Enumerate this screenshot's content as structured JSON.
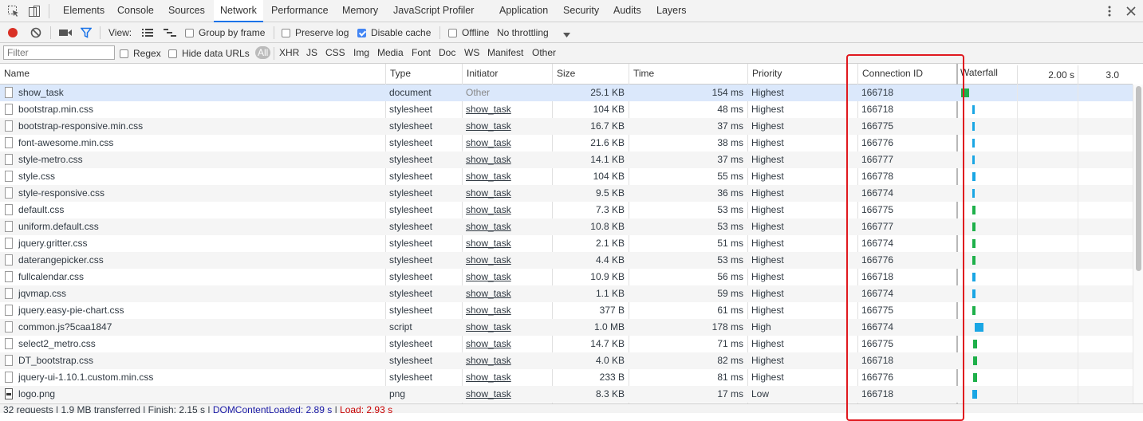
{
  "tabs": [
    "Elements",
    "Console",
    "Sources",
    "Network",
    "Performance",
    "Memory",
    "JavaScript Profiler",
    "Application",
    "Security",
    "Audits",
    "Layers"
  ],
  "toolbar": {
    "view_label": "View:",
    "group_by_frame": "Group by frame",
    "preserve_log": "Preserve log",
    "disable_cache": "Disable cache",
    "offline": "Offline",
    "throttling": "No throttling",
    "disable_cache_checked": true
  },
  "filterbar": {
    "placeholder": "Filter",
    "regex": "Regex",
    "hide_data_urls": "Hide data URLs",
    "types": [
      "All",
      "XHR",
      "JS",
      "CSS",
      "Img",
      "Media",
      "Font",
      "Doc",
      "WS",
      "Manifest",
      "Other"
    ]
  },
  "columns": {
    "name": "Name",
    "type": "Type",
    "initiator": "Initiator",
    "size": "Size",
    "time": "Time",
    "priority": "Priority",
    "connection": "Connection ID",
    "waterfall": "Waterfall",
    "tick1": "2.00 s",
    "tick2": "3.0"
  },
  "rows": [
    {
      "name": "show_task",
      "type": "document",
      "initiator": "Other",
      "size": "25.1 KB",
      "time": "154 ms",
      "priority": "Highest",
      "conn": "166718"
    },
    {
      "name": "bootstrap.min.css",
      "type": "stylesheet",
      "initiator": "show_task",
      "size": "104 KB",
      "time": "48 ms",
      "priority": "Highest",
      "conn": "166718"
    },
    {
      "name": "bootstrap-responsive.min.css",
      "type": "stylesheet",
      "initiator": "show_task",
      "size": "16.7 KB",
      "time": "37 ms",
      "priority": "Highest",
      "conn": "166775"
    },
    {
      "name": "font-awesome.min.css",
      "type": "stylesheet",
      "initiator": "show_task",
      "size": "21.6 KB",
      "time": "38 ms",
      "priority": "Highest",
      "conn": "166776"
    },
    {
      "name": "style-metro.css",
      "type": "stylesheet",
      "initiator": "show_task",
      "size": "14.1 KB",
      "time": "37 ms",
      "priority": "Highest",
      "conn": "166777"
    },
    {
      "name": "style.css",
      "type": "stylesheet",
      "initiator": "show_task",
      "size": "104 KB",
      "time": "55 ms",
      "priority": "Highest",
      "conn": "166778"
    },
    {
      "name": "style-responsive.css",
      "type": "stylesheet",
      "initiator": "show_task",
      "size": "9.5 KB",
      "time": "36 ms",
      "priority": "Highest",
      "conn": "166774"
    },
    {
      "name": "default.css",
      "type": "stylesheet",
      "initiator": "show_task",
      "size": "7.3 KB",
      "time": "53 ms",
      "priority": "Highest",
      "conn": "166775"
    },
    {
      "name": "uniform.default.css",
      "type": "stylesheet",
      "initiator": "show_task",
      "size": "10.8 KB",
      "time": "53 ms",
      "priority": "Highest",
      "conn": "166777"
    },
    {
      "name": "jquery.gritter.css",
      "type": "stylesheet",
      "initiator": "show_task",
      "size": "2.1 KB",
      "time": "51 ms",
      "priority": "Highest",
      "conn": "166774"
    },
    {
      "name": "daterangepicker.css",
      "type": "stylesheet",
      "initiator": "show_task",
      "size": "4.4 KB",
      "time": "53 ms",
      "priority": "Highest",
      "conn": "166776"
    },
    {
      "name": "fullcalendar.css",
      "type": "stylesheet",
      "initiator": "show_task",
      "size": "10.9 KB",
      "time": "56 ms",
      "priority": "Highest",
      "conn": "166718"
    },
    {
      "name": "jqvmap.css",
      "type": "stylesheet",
      "initiator": "show_task",
      "size": "1.1 KB",
      "time": "59 ms",
      "priority": "Highest",
      "conn": "166774"
    },
    {
      "name": "jquery.easy-pie-chart.css",
      "type": "stylesheet",
      "initiator": "show_task",
      "size": "377 B",
      "time": "61 ms",
      "priority": "Highest",
      "conn": "166775"
    },
    {
      "name": "common.js?5caa1847",
      "type": "script",
      "initiator": "show_task",
      "size": "1.0 MB",
      "time": "178 ms",
      "priority": "High",
      "conn": "166774"
    },
    {
      "name": "select2_metro.css",
      "type": "stylesheet",
      "initiator": "show_task",
      "size": "14.7 KB",
      "time": "71 ms",
      "priority": "Highest",
      "conn": "166775"
    },
    {
      "name": "DT_bootstrap.css",
      "type": "stylesheet",
      "initiator": "show_task",
      "size": "4.0 KB",
      "time": "82 ms",
      "priority": "Highest",
      "conn": "166718"
    },
    {
      "name": "jquery-ui-1.10.1.custom.min.css",
      "type": "stylesheet",
      "initiator": "show_task",
      "size": "233 B",
      "time": "81 ms",
      "priority": "Highest",
      "conn": "166776"
    },
    {
      "name": "logo.png",
      "type": "png",
      "initiator": "show_task",
      "size": "8.3 KB",
      "time": "17 ms",
      "priority": "Low",
      "conn": "166718"
    }
  ],
  "status": {
    "summary": "32 requests | 1.9 MB transferred | Finish: 2.15 s | ",
    "dcl": "DOMContentLoaded: 2.89 s",
    "sep": " | ",
    "load": "Load: 2.93 s"
  },
  "colors": {
    "accent": "#1a73e8",
    "highlight": "#e0191f",
    "waterfall_blue": "#1aa6e4",
    "waterfall_green": "#1eb04a"
  }
}
